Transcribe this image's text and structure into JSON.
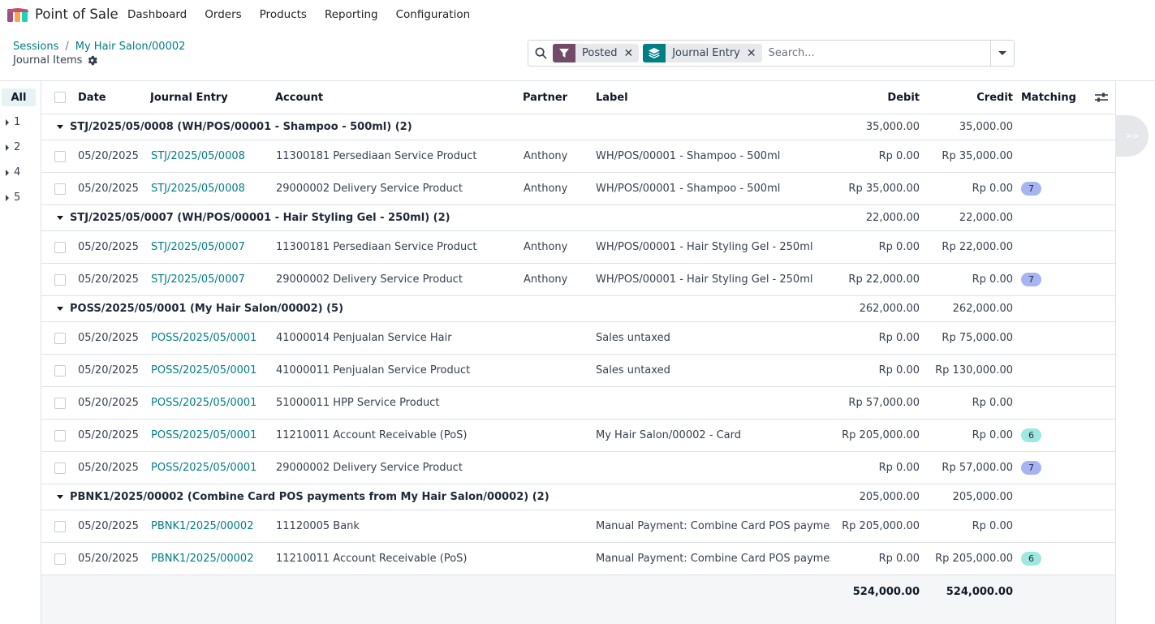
{
  "app": {
    "title": "Point of Sale"
  },
  "nav": [
    "Dashboard",
    "Orders",
    "Products",
    "Reporting",
    "Configuration"
  ],
  "breadcrumb": {
    "root": "Sessions",
    "current": "My Hair Salon/00002",
    "separator": "/"
  },
  "subtitle": "Journal Items",
  "search": {
    "facets": [
      {
        "type": "filter",
        "label": "Posted"
      },
      {
        "type": "group",
        "label": "Journal Entry"
      }
    ],
    "placeholder": "Search..."
  },
  "sidepanel": {
    "all": "All",
    "items": [
      "1",
      "2",
      "4",
      "5"
    ]
  },
  "columns": {
    "date": "Date",
    "journal_entry": "Journal Entry",
    "account": "Account",
    "partner": "Partner",
    "label": "Label",
    "debit": "Debit",
    "credit": "Credit",
    "matching": "Matching"
  },
  "colors": {
    "primary": "#017e84",
    "filter": "#714b67",
    "badge_blue": "#a7b4f2",
    "badge_teal": "#9de8e0"
  },
  "groups": [
    {
      "title": "STJ/2025/05/0008 (WH/POS/00001 - Shampoo - 500ml) (2)",
      "debit": "35,000.00",
      "credit": "35,000.00",
      "rows": [
        {
          "date": "05/20/2025",
          "entry": "STJ/2025/05/0008",
          "account": "11300181 Persediaan Service Product",
          "partner": "Anthony",
          "label": "WH/POS/00001 - Shampoo - 500ml",
          "debit": "Rp 0.00",
          "credit": "Rp 35,000.00",
          "matching": ""
        },
        {
          "date": "05/20/2025",
          "entry": "STJ/2025/05/0008",
          "account": "29000002 Delivery Service Product",
          "partner": "Anthony",
          "label": "WH/POS/00001 - Shampoo - 500ml",
          "debit": "Rp 35,000.00",
          "credit": "Rp 0.00",
          "matching": "7"
        }
      ]
    },
    {
      "title": "STJ/2025/05/0007 (WH/POS/00001 - Hair Styling Gel - 250ml) (2)",
      "debit": "22,000.00",
      "credit": "22,000.00",
      "rows": [
        {
          "date": "05/20/2025",
          "entry": "STJ/2025/05/0007",
          "account": "11300181 Persediaan Service Product",
          "partner": "Anthony",
          "label": "WH/POS/00001 - Hair Styling Gel - 250ml",
          "debit": "Rp 0.00",
          "credit": "Rp 22,000.00",
          "matching": ""
        },
        {
          "date": "05/20/2025",
          "entry": "STJ/2025/05/0007",
          "account": "29000002 Delivery Service Product",
          "partner": "Anthony",
          "label": "WH/POS/00001 - Hair Styling Gel - 250ml",
          "debit": "Rp 22,000.00",
          "credit": "Rp 0.00",
          "matching": "7"
        }
      ]
    },
    {
      "title": "POSS/2025/05/0001 (My Hair Salon/00002) (5)",
      "debit": "262,000.00",
      "credit": "262,000.00",
      "rows": [
        {
          "date": "05/20/2025",
          "entry": "POSS/2025/05/0001",
          "account": "41000014 Penjualan Service Hair",
          "partner": "",
          "label": "Sales untaxed",
          "debit": "Rp 0.00",
          "credit": "Rp 75,000.00",
          "matching": ""
        },
        {
          "date": "05/20/2025",
          "entry": "POSS/2025/05/0001",
          "account": "41000011 Penjualan Service Product",
          "partner": "",
          "label": "Sales untaxed",
          "debit": "Rp 0.00",
          "credit": "Rp 130,000.00",
          "matching": ""
        },
        {
          "date": "05/20/2025",
          "entry": "POSS/2025/05/0001",
          "account": "51000011 HPP Service Product",
          "partner": "",
          "label": "",
          "debit": "Rp 57,000.00",
          "credit": "Rp 0.00",
          "matching": ""
        },
        {
          "date": "05/20/2025",
          "entry": "POSS/2025/05/0001",
          "account": "11210011 Account Receivable (PoS)",
          "partner": "",
          "label": "My Hair Salon/00002 - Card",
          "debit": "Rp 205,000.00",
          "credit": "Rp 0.00",
          "matching": "6"
        },
        {
          "date": "05/20/2025",
          "entry": "POSS/2025/05/0001",
          "account": "29000002 Delivery Service Product",
          "partner": "",
          "label": "",
          "debit": "Rp 0.00",
          "credit": "Rp 57,000.00",
          "matching": "7"
        }
      ]
    },
    {
      "title": "PBNK1/2025/00002 (Combine Card POS payments from My Hair Salon/00002) (2)",
      "debit": "205,000.00",
      "credit": "205,000.00",
      "rows": [
        {
          "date": "05/20/2025",
          "entry": "PBNK1/2025/00002",
          "account": "11120005 Bank",
          "partner": "",
          "label": "Manual Payment: Combine Card POS payme...",
          "debit": "Rp 205,000.00",
          "credit": "Rp 0.00",
          "matching": ""
        },
        {
          "date": "05/20/2025",
          "entry": "PBNK1/2025/00002",
          "account": "11210011 Account Receivable (PoS)",
          "partner": "",
          "label": "Manual Payment: Combine Card POS payme...",
          "debit": "Rp 0.00",
          "credit": "Rp 205,000.00",
          "matching": "6"
        }
      ]
    }
  ],
  "totals": {
    "debit": "524,000.00",
    "credit": "524,000.00"
  },
  "expand_label": ">>"
}
